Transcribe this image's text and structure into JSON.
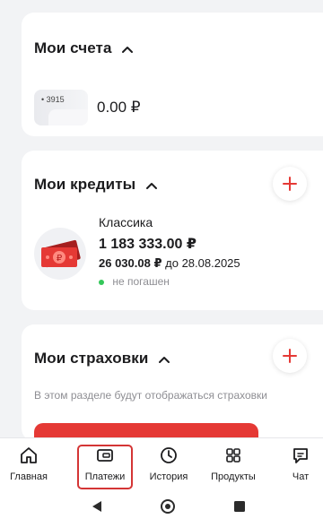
{
  "accounts": {
    "title": "Мои счета",
    "card_number": "• 3915",
    "balance": "0.00 ₽"
  },
  "credits": {
    "title": "Мои кредиты",
    "item": {
      "name": "Классика",
      "amount": "1 183 333.00 ₽",
      "payment": "26 030.08 ₽",
      "payment_due_prefix": "до",
      "payment_due_date": "28.08.2025",
      "status": "не погашен"
    }
  },
  "insurance": {
    "title": "Мои страховки",
    "empty_text": "В этом разделе будут отображаться страховки"
  },
  "nav": {
    "items": [
      {
        "label": "Главная",
        "icon": "home-icon"
      },
      {
        "label": "Платежи",
        "icon": "wallet-icon"
      },
      {
        "label": "История",
        "icon": "clock-icon"
      },
      {
        "label": "Продукты",
        "icon": "grid-icon"
      },
      {
        "label": "Чат",
        "icon": "chat-icon"
      }
    ],
    "active_index": 1
  },
  "colors": {
    "accent": "#e53935",
    "status_active": "#34c759",
    "background": "#f2f3f5"
  }
}
